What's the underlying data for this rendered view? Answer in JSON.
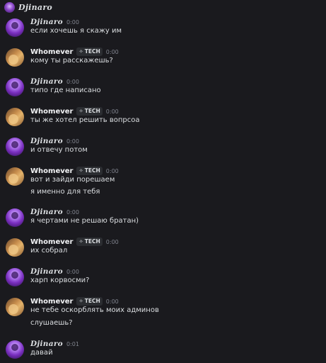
{
  "header": {
    "name": "Djinaro"
  },
  "users": {
    "djinaro": {
      "name": "Djinaro"
    },
    "whomever": {
      "name": "Whomever",
      "tag": "TECH",
      "tag_icon": "diamond-sparkle-icon"
    }
  },
  "messages": [
    {
      "author": "Djinaro",
      "time": "0:00",
      "lines": [
        "если хочешь я скажу им"
      ]
    },
    {
      "author": "Whomever",
      "time": "0:00",
      "lines": [
        "кому ты расскажешь?"
      ]
    },
    {
      "author": "Djinaro",
      "time": "0:00",
      "lines": [
        "типо где написано"
      ]
    },
    {
      "author": "Whomever",
      "time": "0:00",
      "lines": [
        "ты же хотел решить вопрсоа"
      ]
    },
    {
      "author": "Djinaro",
      "time": "0:00",
      "lines": [
        "и отвечу потом"
      ]
    },
    {
      "author": "Whomever",
      "time": "0:00",
      "lines": [
        "вот и зайди порешаем",
        "я именно для тебя"
      ]
    },
    {
      "author": "Djinaro",
      "time": "0:00",
      "lines": [
        "я чертами не решаю братан)"
      ]
    },
    {
      "author": "Whomever",
      "time": "0:00",
      "lines": [
        "их собрал"
      ]
    },
    {
      "author": "Djinaro",
      "time": "0:00",
      "lines": [
        "харп корвосми?"
      ]
    },
    {
      "author": "Whomever",
      "time": "0:00",
      "lines": [
        "не тебе оскорблять моих админов",
        "слушаешь?"
      ]
    },
    {
      "author": "Djinaro",
      "time": "0:01",
      "lines": [
        "давай"
      ]
    }
  ],
  "colors": {
    "background": "#1a1a1e",
    "text": "#dbdee1",
    "timestamp": "#80848e",
    "badge_bg": "#2b2d31"
  }
}
